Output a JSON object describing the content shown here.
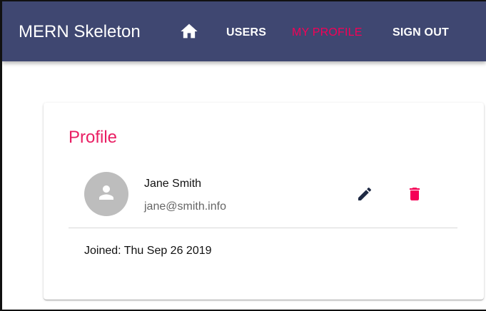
{
  "app": {
    "title": "MERN Skeleton"
  },
  "nav": {
    "home_icon": "home-icon",
    "users_label": "USERS",
    "my_profile_label": "MY PROFILE",
    "sign_out_label": "SIGN OUT",
    "active_item": "MY PROFILE"
  },
  "profile": {
    "title": "Profile",
    "name": "Jane Smith",
    "email": "jane@smith.info",
    "joined_text": "Joined: Thu Sep 26 2019",
    "avatar_icon": "person-icon",
    "edit_icon": "edit-icon",
    "delete_icon": "delete-icon"
  },
  "colors": {
    "appbar": "#3f4771",
    "accent": "#f50057",
    "title": "#e91e63",
    "avatar": "#bdbdbd",
    "edit_icon": "#1f2a44",
    "delete_icon": "#f50057"
  }
}
